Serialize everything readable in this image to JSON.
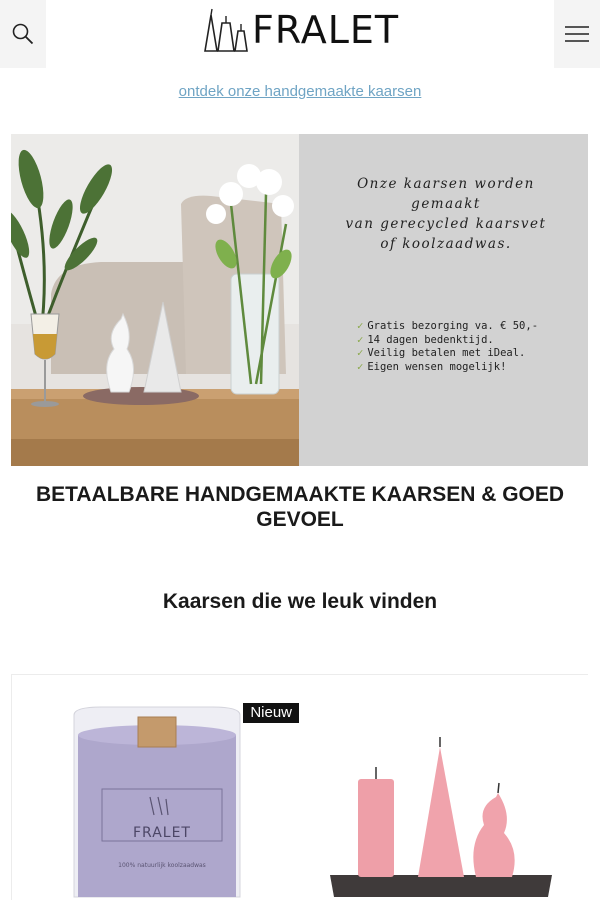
{
  "header": {
    "brand": "FRALET",
    "search_icon": "search-icon",
    "menu_icon": "hamburger-menu-icon"
  },
  "promo": {
    "link_text": "ontdek onze handgemaakte kaarsen"
  },
  "hero": {
    "quote_line1": "Onze kaarsen worden gemaakt",
    "quote_line2": "van gerecycled kaarsvet",
    "quote_line3": "of koolzaadwas.",
    "benefits": [
      "Gratis bezorging va. € 50,-",
      "14 dagen bedenktijd.",
      "Veilig betalen met iDeal.",
      "Eigen wensen mogelijk!"
    ],
    "check_icon": "✓"
  },
  "headline": "BETAALBARE HANDGEMAAKTE KAARSEN & GOED GEVOEL",
  "section": {
    "title": "Kaarsen die we leuk vinden"
  },
  "products": [
    {
      "badge": "Nieuw",
      "jar_brand": "FRALET",
      "jar_caption": "100% natuurlijk koolzaadwas"
    },
    {
      "badge": ""
    }
  ],
  "colors": {
    "link": "#6fa4c4",
    "panel_grey": "#d2d2d2",
    "check_green": "#8aa84a",
    "badge_bg": "#111111"
  }
}
